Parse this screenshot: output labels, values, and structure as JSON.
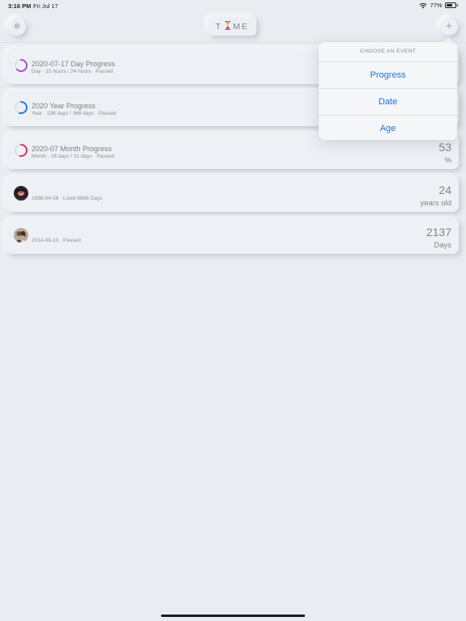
{
  "status_bar": {
    "time": "3:16 PM",
    "date": "Fri Jul 17",
    "battery": "77%",
    "battery_fraction": 0.77
  },
  "header": {
    "logo_left": "T",
    "logo_right": "ME",
    "settings_icon": "gear-icon",
    "add_icon": "plus-icon"
  },
  "events": [
    {
      "title": "2020-07-17 Day Progress",
      "subtitle": "Day · 15 hours / 24 hours · Passed",
      "value": "",
      "unit": "",
      "ring_color": "#b04ad8",
      "progress": 0.625
    },
    {
      "title": "2020 Year Progress",
      "subtitle": "Year · 198 days / 366 days · Passed",
      "value": "",
      "unit": "",
      "ring_color": "#1f7fe0",
      "progress": 0.54
    },
    {
      "title": "2020-07 Month Progress",
      "subtitle": "Month · 16 days / 31 days · Passed",
      "value": "53",
      "unit": "%",
      "ring_color": "#e8325a",
      "progress": 0.53
    },
    {
      "title": "",
      "subtitle": "1996-04-08 · Lived 8866 Days",
      "value": "24",
      "unit": "years old",
      "avatar_icon": "person-photo-icon"
    },
    {
      "title": "",
      "subtitle": "2014-09-10 · Passed",
      "value": "2137",
      "unit": "Days",
      "avatar_icon": "couple-photo-icon"
    }
  ],
  "popover": {
    "header": "CHOOSE AN EVENT",
    "items": [
      "Progress",
      "Date",
      "Age"
    ]
  }
}
